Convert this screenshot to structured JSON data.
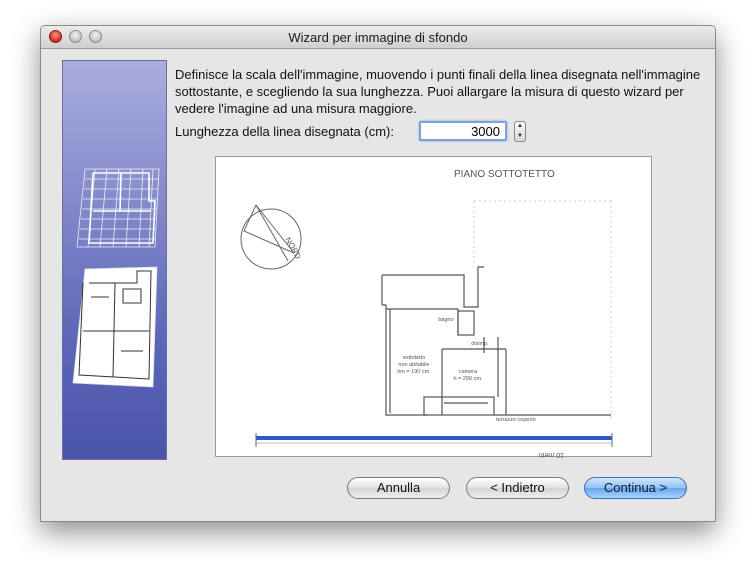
{
  "window": {
    "title": "Wizard per immagine di sfondo"
  },
  "description": "Definisce la scala dell'immagine, muovendo i punti finali della linea disegnata nell'immagine sottostante, e scegliendo la sua lunghezza. Puoi allargare la misura di questo wizard per vedere l'imagine ad una misura maggiore.",
  "length": {
    "label": "Lunghezza della linea disegnata (cm):",
    "value": "3000"
  },
  "plan": {
    "title": "PIANO SOTTOTETTO",
    "compass_label": "NORD",
    "room1": [
      "sottotetto",
      "non abitabile",
      "hm = 190 cm."
    ],
    "room2": [
      "camera",
      "h = 290 cm."
    ],
    "small_labels": [
      "bagno",
      "disimp.",
      "terrazzo coperto"
    ],
    "scale_label": "10 metri",
    "scale_color": "#2a5bc9"
  },
  "buttons": {
    "cancel": "Annulla",
    "back": "< Indietro",
    "next": "Continua >"
  },
  "colors": {
    "accent": "#66a6ea",
    "sidebar": "#5d66b8"
  }
}
